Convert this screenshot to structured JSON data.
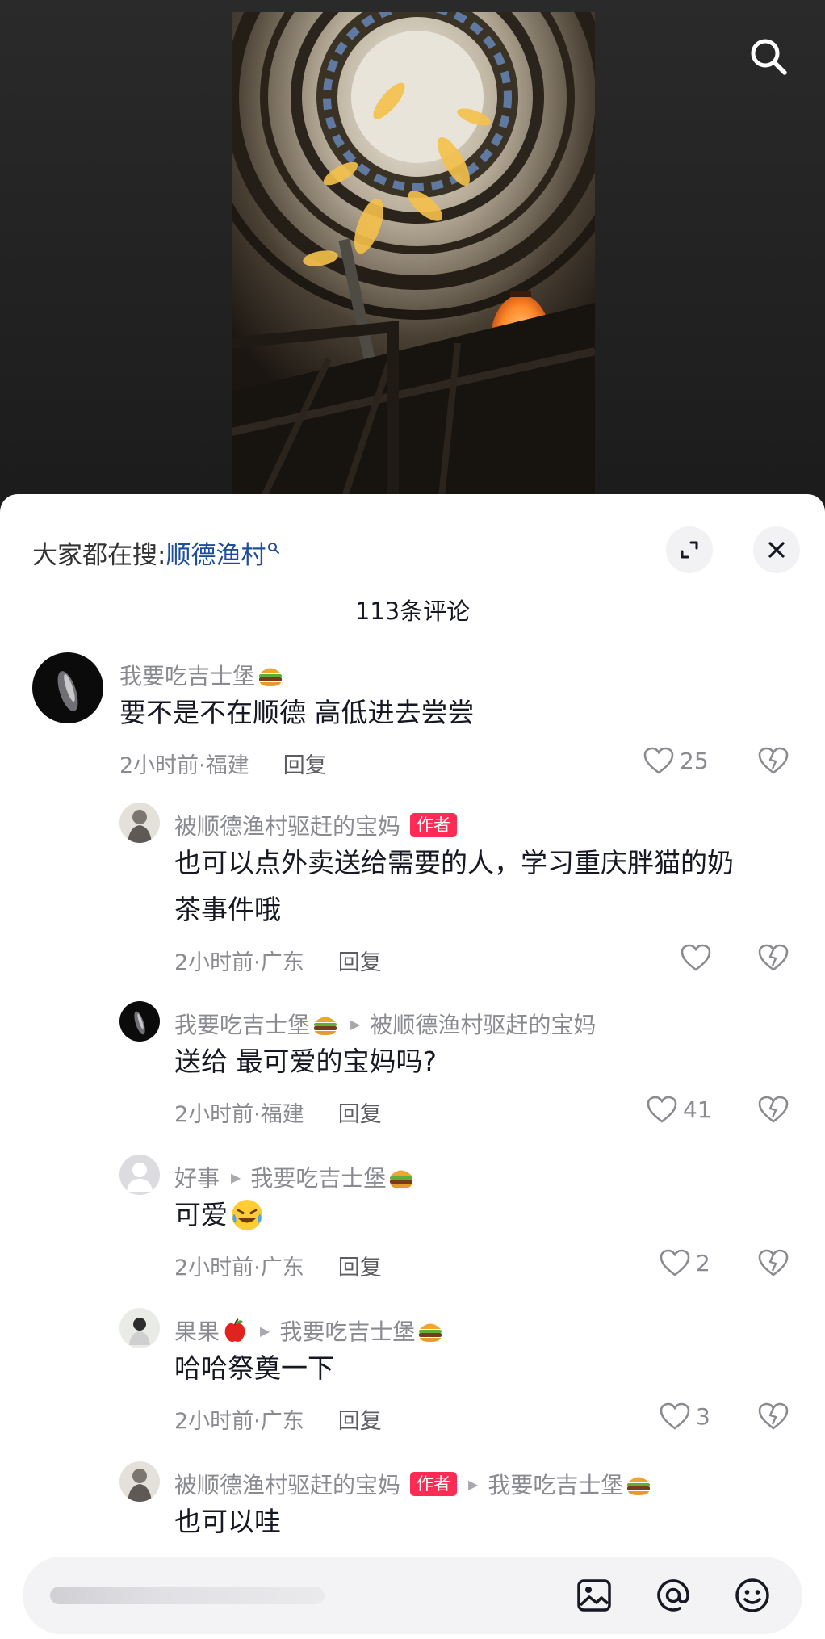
{
  "colors": {
    "accent": "#fe2c55",
    "link": "#1f4e9b",
    "meta": "#8a8b91"
  },
  "header": {
    "hot_search_prefix": "大家都在搜:",
    "hot_search_keyword": "顺德渔村",
    "comment_count": "113条评论"
  },
  "comments": [
    {
      "user": "我要吃吉士堡",
      "user_emoji": "hamburger",
      "text": "要不是不在顺德 高低进去尝尝",
      "time": "2小时前·福建",
      "reply_label": "回复",
      "likes": "25"
    },
    {
      "user": "被顺德渔村驱赶的宝妈",
      "badge": "作者",
      "text_line1": "也可以点外卖送给需要的人，学习重庆胖猫的奶",
      "text_line2": "茶事件哦",
      "time": "2小时前·广东",
      "reply_label": "回复",
      "likes": ""
    },
    {
      "user": "我要吃吉士堡",
      "user_emoji": "hamburger",
      "reply_to": "被顺德渔村驱赶的宝妈",
      "text": "送给 最可爱的宝妈吗?",
      "time": "2小时前·福建",
      "reply_label": "回复",
      "likes": "41"
    },
    {
      "user": "好事",
      "reply_to": "我要吃吉士堡",
      "reply_to_emoji": "hamburger",
      "text": "可爱",
      "text_emoji": "laughing-crying",
      "time": "2小时前·广东",
      "reply_label": "回复",
      "likes": "2"
    },
    {
      "user": "果果",
      "user_emoji": "apple",
      "reply_to": "我要吃吉士堡",
      "reply_to_emoji": "hamburger",
      "text": "哈哈祭奠一下",
      "time": "2小时前·广东",
      "reply_label": "回复",
      "likes": "3"
    },
    {
      "user": "被顺德渔村驱赶的宝妈",
      "badge": "作者",
      "reply_to": "我要吃吉士堡",
      "reply_to_emoji": "hamburger",
      "text": "也可以哇"
    }
  ],
  "input_bar": {
    "icons": [
      "image-icon",
      "at-icon",
      "emoji-icon"
    ]
  }
}
